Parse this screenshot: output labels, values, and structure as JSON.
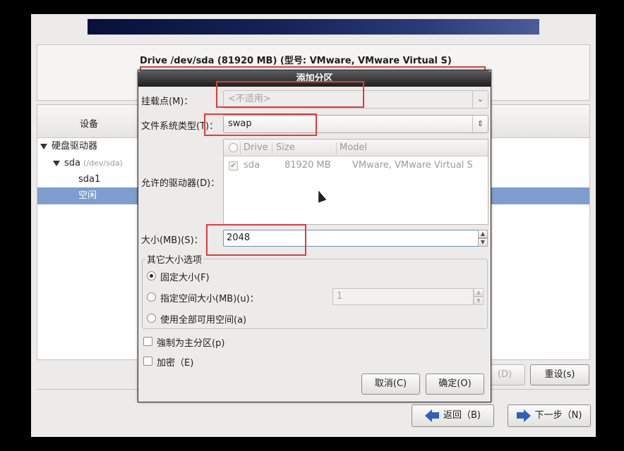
{
  "installer": {
    "drive_title": "Drive /dev/sda (81920 MB) (型号: VMware, VMware Virtual S)",
    "tree": {
      "column_header": "设备",
      "rows": [
        {
          "label": "硬盘驱动器",
          "sublabel": ""
        },
        {
          "label": "sda",
          "sublabel": "(/dev/sda)"
        },
        {
          "label": "sda1",
          "sublabel": ""
        },
        {
          "label": "空闲",
          "sublabel": ""
        }
      ]
    },
    "buttons": {
      "delete": "(D)",
      "reset": "重设(s)",
      "back": "返回（B)",
      "next": "下一步（N)"
    }
  },
  "dialog": {
    "title": "添加分区",
    "mount_point_label": "挂载点(M)：",
    "mount_point_value": "<不适用>",
    "fs_type_label": "文件系统类型(T)：",
    "fs_type_value": "swap",
    "allowed_drives_label": "允许的驱动器(D)：",
    "drives_table": {
      "headers": [
        "Drive",
        "Size",
        "Model"
      ],
      "rows": [
        {
          "drive": "sda",
          "size": "81920 MB",
          "model": "VMware, VMware Virtual S",
          "checked": true
        }
      ]
    },
    "size_label": "大小(MB)(S)：",
    "size_value": "2048",
    "other_size_options_label": "其它大小选项",
    "options": [
      {
        "label": "固定大小(F)",
        "selected": true
      },
      {
        "label": "指定空间大小(MB)(u)：",
        "selected": false
      },
      {
        "label": "使用全部可用空间(a)",
        "selected": false
      }
    ],
    "max_size_value": "1",
    "force_primary_label": "強制为主分区(p)",
    "encrypt_label": "加密（E)",
    "cancel_label": "取消(C)",
    "ok_label": "确定(O)"
  }
}
